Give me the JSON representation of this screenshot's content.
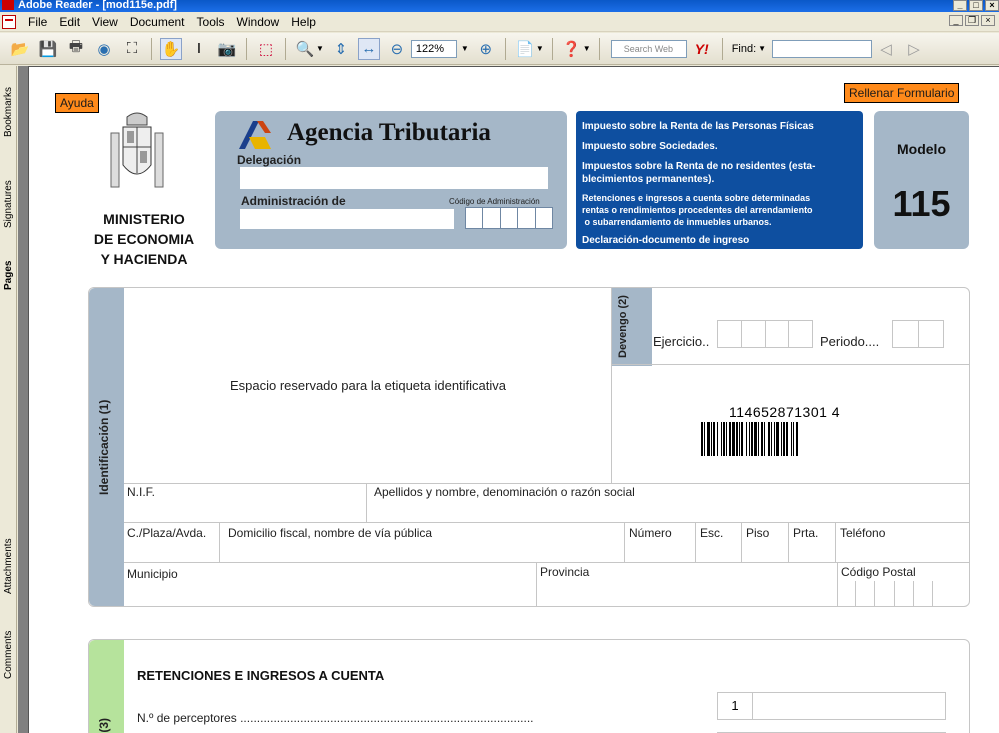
{
  "window": {
    "title": "Adobe Reader - [mod115e.pdf]"
  },
  "menu": [
    "File",
    "Edit",
    "View",
    "Document",
    "Tools",
    "Window",
    "Help"
  ],
  "toolbar": {
    "zoom": "122%",
    "search_placeholder": "Search Web",
    "find_label": "Find:",
    "yahoo": "Y!"
  },
  "side_tabs": {
    "bookmarks": "Bookmarks",
    "signatures": "Signatures",
    "pages": "Pages",
    "attachments": "Attachments",
    "comments": "Comments"
  },
  "form": {
    "help_button": "Ayuda",
    "fill_button": "Rellenar Formulario",
    "ministry": [
      "MINISTERIO",
      "DE ECONOMIA",
      "Y HACIENDA"
    ],
    "agency": "Agencia Tributaria",
    "delegacion": "Delegación",
    "administracion": "Administración de",
    "codigo_admin": "Código de Administración",
    "blue_lines": [
      "Impuesto sobre la Renta de las Personas Físicas",
      "Impuesto sobre Sociedades.",
      "Impuestos sobre la Renta de no residentes (esta-",
      "blecimientos permanentes).",
      "Retenciones  e ingresos a cuenta sobre determinadas",
      "rentas o rendimientos procedentes del arrendamiento",
      " o subarrendamiento de inmuebles urbanos.",
      "Declaración-documento de ingreso"
    ],
    "modelo_label": "Modelo",
    "modelo_number": "115",
    "identificacion": "Identificación (1)",
    "etiqueta": "Espacio reservado para la etiqueta identificativa",
    "devengo": "Devengo (2)",
    "ejercicio": "Ejercicio..",
    "periodo": "Periodo....",
    "barcode_number": "114652871301 4",
    "nif": "N.I.F.",
    "apellidos": "Apellidos y nombre, denominación o razón social",
    "calle": "C./Plaza/Avda.",
    "domicilio": "Domicilio fiscal, nombre de vía pública",
    "numero": "Número",
    "esc": "Esc.",
    "piso": "Piso",
    "prta": "Prta.",
    "telefono": "Teléfono",
    "municipio": "Municipio",
    "provincia": "Provincia",
    "codigo_postal": "Código Postal",
    "retenciones_title": "RETENCIONES E INGRESOS A CUENTA",
    "perceptores_label": "N.º de perceptores ........................................................................................",
    "perceptores_box_num": "1",
    "section3_partial": "(3)"
  }
}
